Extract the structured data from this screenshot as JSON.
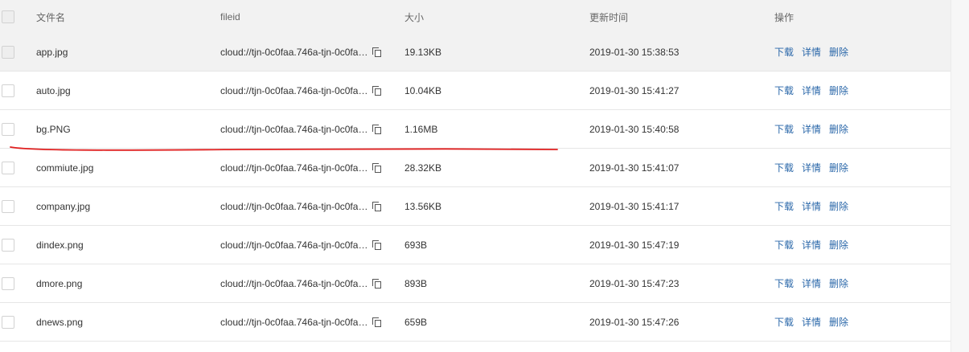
{
  "header": {
    "name_label": "文件名",
    "fileid_label": "fileid",
    "size_label": "大小",
    "time_label": "更新时间",
    "ops_label": "操作"
  },
  "rows": [
    {
      "name": "app.jpg",
      "fileid": "cloud://tjn-0c0faa.746a-tjn-0c0fa…",
      "size": "19.13KB",
      "time": "2019-01-30 15:38:53"
    },
    {
      "name": "auto.jpg",
      "fileid": "cloud://tjn-0c0faa.746a-tjn-0c0fa…",
      "size": "10.04KB",
      "time": "2019-01-30 15:41:27"
    },
    {
      "name": "bg.PNG",
      "fileid": "cloud://tjn-0c0faa.746a-tjn-0c0fa…",
      "size": "1.16MB",
      "time": "2019-01-30 15:40:58"
    },
    {
      "name": "commiute.jpg",
      "fileid": "cloud://tjn-0c0faa.746a-tjn-0c0fa…",
      "size": "28.32KB",
      "time": "2019-01-30 15:41:07"
    },
    {
      "name": "company.jpg",
      "fileid": "cloud://tjn-0c0faa.746a-tjn-0c0fa…",
      "size": "13.56KB",
      "time": "2019-01-30 15:41:17"
    },
    {
      "name": "dindex.png",
      "fileid": "cloud://tjn-0c0faa.746a-tjn-0c0fa…",
      "size": "693B",
      "time": "2019-01-30 15:47:19"
    },
    {
      "name": "dmore.png",
      "fileid": "cloud://tjn-0c0faa.746a-tjn-0c0fa…",
      "size": "893B",
      "time": "2019-01-30 15:47:23"
    },
    {
      "name": "dnews.png",
      "fileid": "cloud://tjn-0c0faa.746a-tjn-0c0fa…",
      "size": "659B",
      "time": "2019-01-30 15:47:26"
    }
  ],
  "ops": {
    "download": "下载",
    "details": "详情",
    "delete": "删除"
  },
  "colors": {
    "link": "#2a67a9",
    "header_bg": "#f2f2f2",
    "annotation": "#e02020"
  },
  "icons": {
    "copy": "copy-icon"
  }
}
